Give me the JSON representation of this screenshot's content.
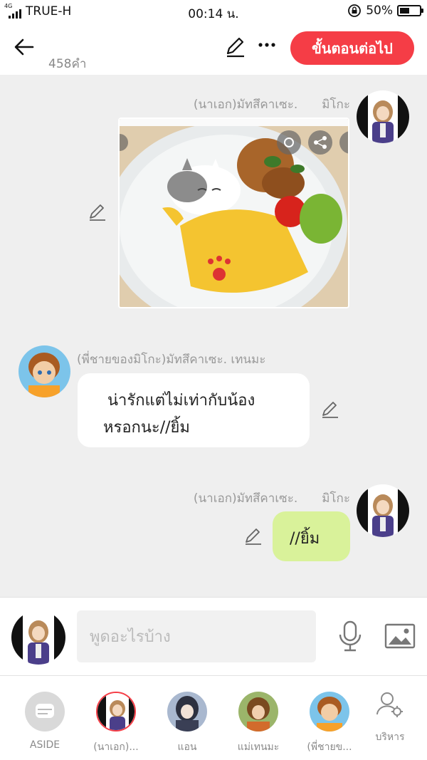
{
  "status_bar": {
    "network": "4G",
    "carrier": "TRUE-H",
    "time": "00:14 น.",
    "battery": "50%",
    "battery_level": 0.5
  },
  "header": {
    "word_count": "458คำ",
    "next_button": "ขั้นตอนต่อไป"
  },
  "messages": [
    {
      "side": "right",
      "sender": "(นาเอก)มัทสึคาเซะ.　　มิโกะ",
      "type": "image",
      "image_desc_icons": [
        "zoom-icon",
        "share-icon"
      ]
    },
    {
      "side": "left",
      "sender": "(พี่ชายของมิโกะ)มัทสึคาเซะ.  เทนมะ",
      "type": "text",
      "text_line1": "น่ารักแต่ไม่เท่ากับน้อง",
      "text_line2": "หรอกนะ//ยิ้ม"
    },
    {
      "side": "right",
      "sender": "(นาเอก)มัทสึคาเซะ.　　มิโกะ",
      "type": "text",
      "text": "//ยิ้ม"
    }
  ],
  "composer": {
    "placeholder": "พูดอะไรบ้าง"
  },
  "characters": [
    {
      "label": "ASIDE"
    },
    {
      "label": "(นาเอก)..."
    },
    {
      "label": "แอน"
    },
    {
      "label": "แม่เทนมะ"
    },
    {
      "label": "(พี่ชายข..."
    }
  ],
  "manage_label": "บริหาร",
  "colors": {
    "accent": "#f53d46",
    "my_bubble": "#d9f29a",
    "other_bubble": "#ffffff"
  }
}
